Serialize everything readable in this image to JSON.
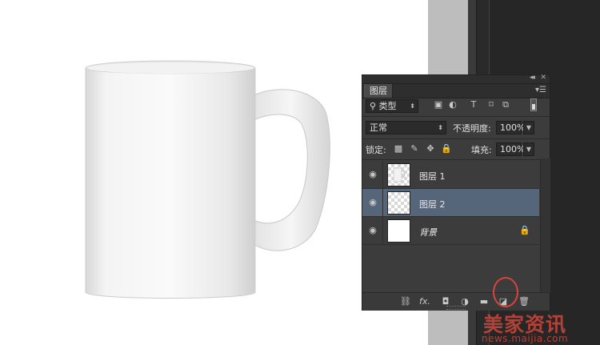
{
  "panel": {
    "tab_label": "图层",
    "collapse_glyph": "◂◂",
    "close_glyph": "✕",
    "menu_glyph": "▾☰"
  },
  "filter": {
    "kind_label": "类型",
    "icons": [
      "image-filter-icon",
      "adjustment-filter-icon",
      "text-filter-icon",
      "shape-filter-icon",
      "smart-object-filter-icon"
    ]
  },
  "blend": {
    "mode": "正常",
    "opacity_label": "不透明度:",
    "opacity_value": "100%"
  },
  "locks": {
    "lock_label": "锁定:",
    "fill_label": "填充:",
    "fill_value": "100%"
  },
  "layers": [
    {
      "name": "图层 1",
      "selected": false,
      "thumb": "mug"
    },
    {
      "name": "图层 2",
      "selected": true,
      "thumb": "transparent"
    },
    {
      "name": "背景",
      "selected": false,
      "thumb": "white",
      "locked": true
    }
  ],
  "footer_buttons": [
    "link-layers-icon",
    "fx-icon",
    "add-mask-icon",
    "adjustment-layer-icon",
    "new-group-icon",
    "new-layer-icon",
    "delete-layer-icon"
  ],
  "footer": {
    "fx_label": "fx."
  },
  "watermark": {
    "title": "美家资讯",
    "url": "news.maijia.com"
  },
  "colors": {
    "selected_layer": "#56667a",
    "highlight_ring": "#d9443b",
    "panel_bg": "#3c3c3c"
  }
}
